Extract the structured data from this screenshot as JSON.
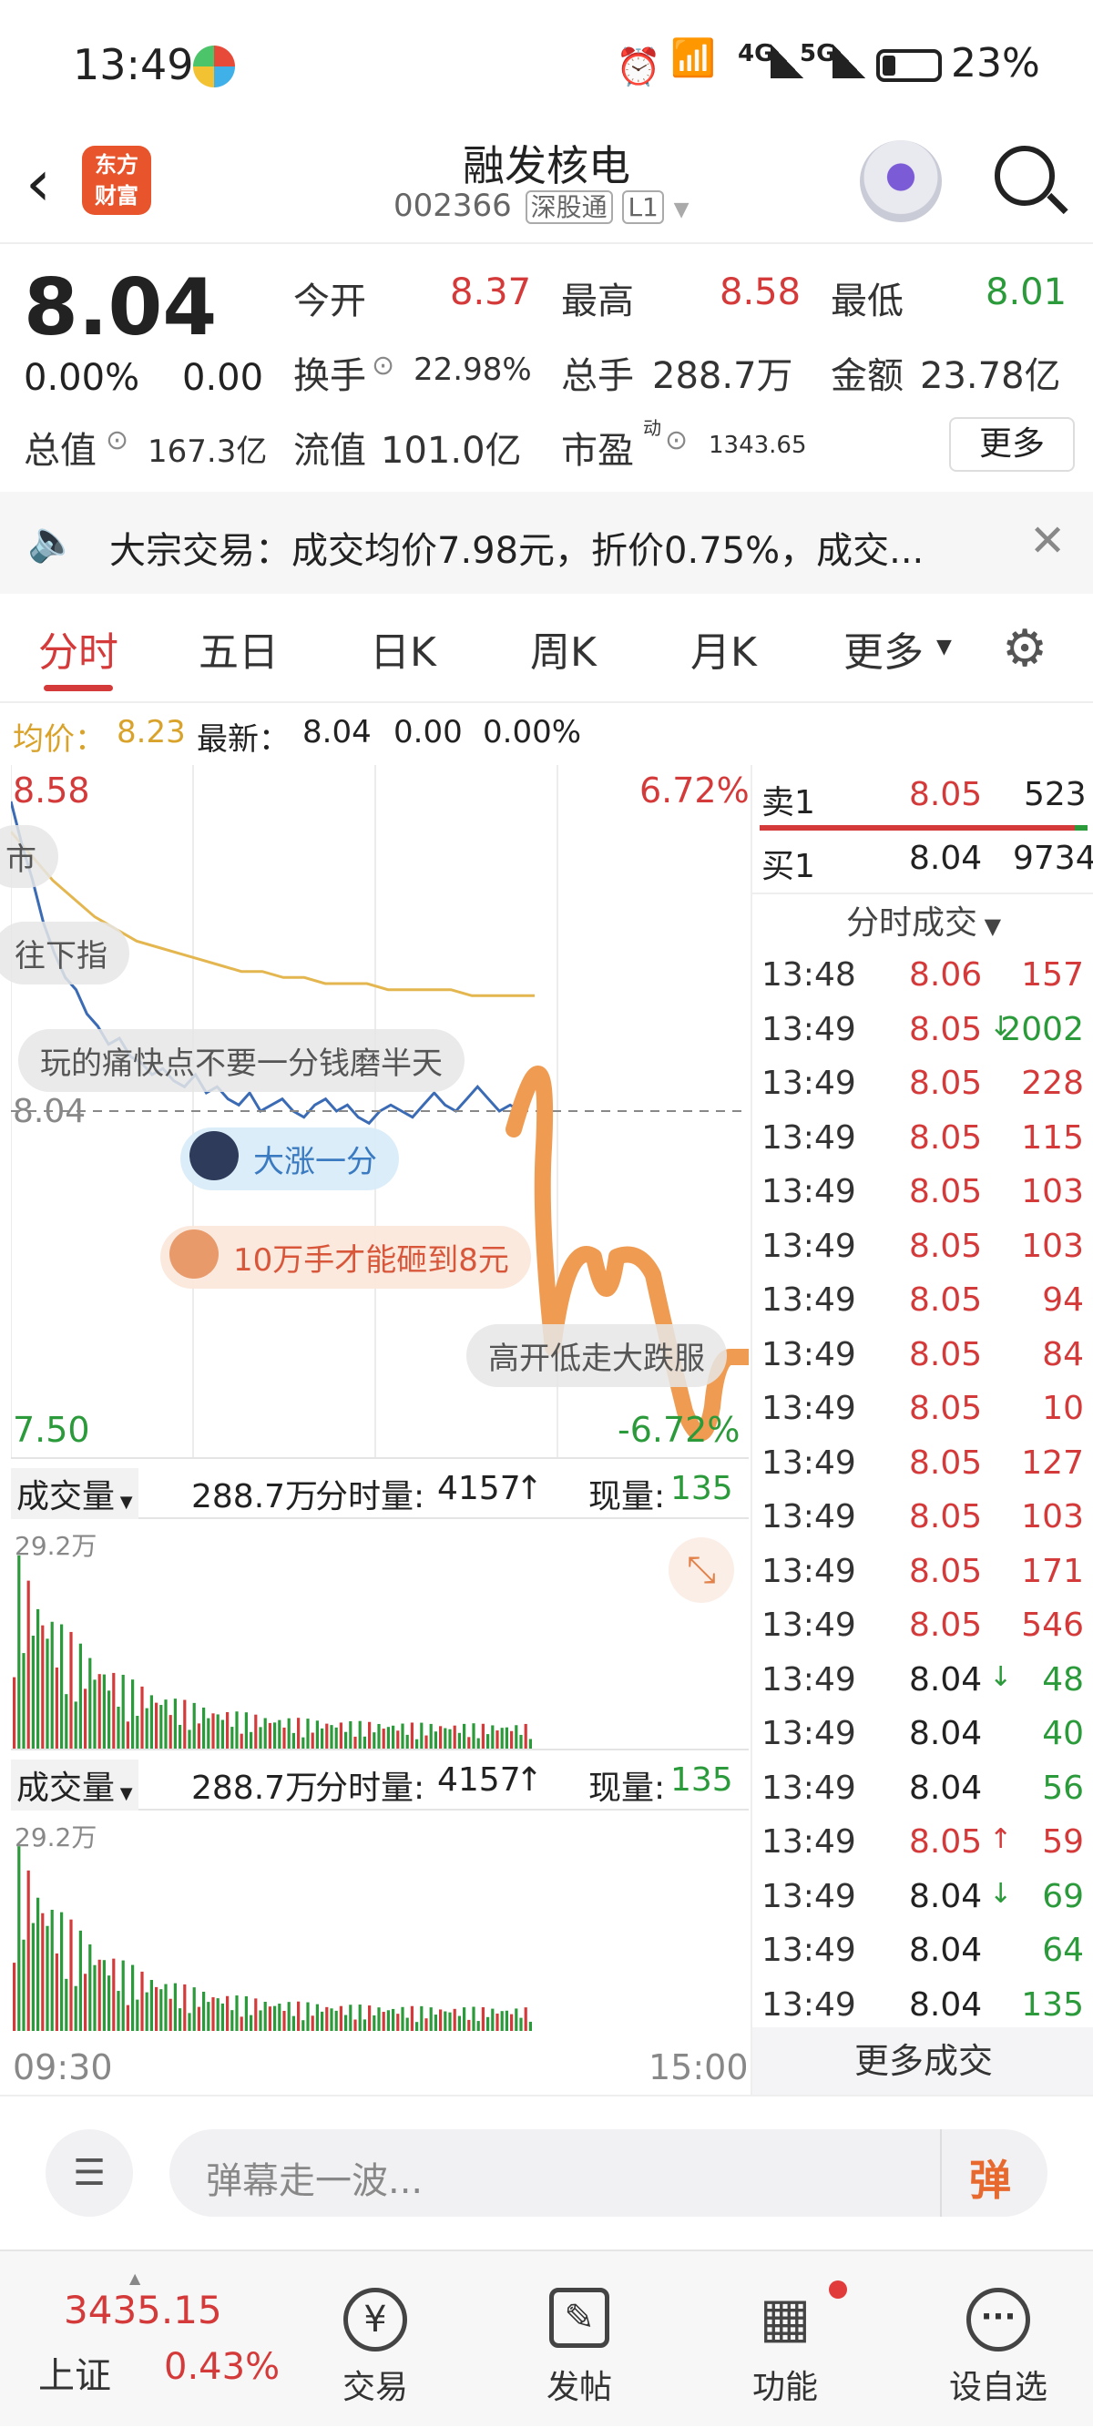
{
  "status": {
    "time": "13:49",
    "wifi_label": "6",
    "net1": "4G",
    "net2": "5G",
    "battery": "23%"
  },
  "nav": {
    "title": "融发核电",
    "code": "002366",
    "market": "深股通",
    "level": "L1",
    "logo_line1": "东方",
    "logo_line2": "财富"
  },
  "quote": {
    "price": "8.04",
    "change_pct": "0.00%",
    "change": "0.00",
    "open_label": "今开",
    "open": "8.37",
    "high_label": "最高",
    "high": "8.58",
    "low_label": "最低",
    "low": "8.01",
    "turnover_label": "换手",
    "turnover": "22.98%",
    "vol_label": "总手",
    "vol": "288.7万",
    "amount_label": "金额",
    "amount": "23.78亿",
    "mktcap_label": "总值",
    "mktcap": "167.3亿",
    "float_label": "流值",
    "float": "101.0亿",
    "pe_label": "市盈",
    "pe_sup": "动",
    "pe": "1343.65",
    "more": "更多"
  },
  "notice": {
    "text": "大宗交易：成交均价7.98元，折价0.75%，成交..."
  },
  "tabs": [
    "分时",
    "五日",
    "日K",
    "周K",
    "月K",
    "更多"
  ],
  "info": {
    "avg_label": "均价：",
    "avg": "8.23",
    "latest_label": "最新：",
    "latest": "8.04",
    "chg": "0.00",
    "pct": "0.00%"
  },
  "chart_data": {
    "type": "line",
    "title": "",
    "y_range": [
      7.5,
      8.58
    ],
    "y_pct_range": [
      "-6.72%",
      "6.72%"
    ],
    "ref_price": "8.04",
    "x_start": "09:30",
    "x_end": "15:00",
    "labels": {
      "ymax": "8.58",
      "ymin": "7.50",
      "pct_max": "6.72%",
      "pct_min": "-6.72%",
      "ref": "8.04"
    },
    "price": [
      8.55,
      8.48,
      8.42,
      8.35,
      8.3,
      8.26,
      8.24,
      8.2,
      8.18,
      8.15,
      8.16,
      8.13,
      8.12,
      8.1,
      8.11,
      8.09,
      8.08,
      8.1,
      8.07,
      8.08,
      8.06,
      8.05,
      8.07,
      8.04,
      8.05,
      8.06,
      8.04,
      8.03,
      8.05,
      8.06,
      8.04,
      8.05,
      8.03,
      8.02,
      8.04,
      8.05,
      8.04,
      8.03,
      8.05,
      8.07,
      8.05,
      8.04,
      8.06,
      8.08,
      8.06,
      8.04,
      8.05,
      8.04
    ],
    "avg": [
      8.5,
      8.46,
      8.42,
      8.39,
      8.36,
      8.34,
      8.32,
      8.31,
      8.3,
      8.29,
      8.28,
      8.27,
      8.27,
      8.26,
      8.26,
      8.25,
      8.25,
      8.25,
      8.24,
      8.24,
      8.24,
      8.24,
      8.23,
      8.23,
      8.23,
      8.23
    ]
  },
  "volume": {
    "label": "成交量",
    "total": "288.7万",
    "period_label": "分时量:",
    "period": "4157",
    "current_label": "现量:",
    "current": "135",
    "max": "29.2万"
  },
  "danmaku": [
    "市",
    "往下指",
    "玩的痛快点不要一分钱磨半天",
    "大涨一分",
    "10万手才能砸到8元",
    "高开低走大跌服"
  ],
  "book": {
    "ask_label": "卖1",
    "ask_price": "8.05",
    "ask_vol": "523",
    "bid_label": "买1",
    "bid_price": "8.04",
    "bid_vol": "9734",
    "ticks_title": "分时成交",
    "more": "更多成交",
    "ticks": [
      {
        "t": "13:48",
        "p": "8.06",
        "v": "157",
        "pc": "red",
        "vc": "red",
        "arrow": ""
      },
      {
        "t": "13:49",
        "p": "8.05",
        "v": "2002",
        "pc": "red",
        "vc": "green",
        "arrow": "↓"
      },
      {
        "t": "13:49",
        "p": "8.05",
        "v": "228",
        "pc": "red",
        "vc": "red",
        "arrow": ""
      },
      {
        "t": "13:49",
        "p": "8.05",
        "v": "115",
        "pc": "red",
        "vc": "red",
        "arrow": ""
      },
      {
        "t": "13:49",
        "p": "8.05",
        "v": "103",
        "pc": "red",
        "vc": "red",
        "arrow": ""
      },
      {
        "t": "13:49",
        "p": "8.05",
        "v": "103",
        "pc": "red",
        "vc": "red",
        "arrow": ""
      },
      {
        "t": "13:49",
        "p": "8.05",
        "v": "94",
        "pc": "red",
        "vc": "red",
        "arrow": ""
      },
      {
        "t": "13:49",
        "p": "8.05",
        "v": "84",
        "pc": "red",
        "vc": "red",
        "arrow": ""
      },
      {
        "t": "13:49",
        "p": "8.05",
        "v": "10",
        "pc": "red",
        "vc": "red",
        "arrow": ""
      },
      {
        "t": "13:49",
        "p": "8.05",
        "v": "127",
        "pc": "red",
        "vc": "red",
        "arrow": ""
      },
      {
        "t": "13:49",
        "p": "8.05",
        "v": "103",
        "pc": "red",
        "vc": "red",
        "arrow": ""
      },
      {
        "t": "13:49",
        "p": "8.05",
        "v": "171",
        "pc": "red",
        "vc": "red",
        "arrow": ""
      },
      {
        "t": "13:49",
        "p": "8.05",
        "v": "546",
        "pc": "red",
        "vc": "red",
        "arrow": ""
      },
      {
        "t": "13:49",
        "p": "8.04",
        "v": "48",
        "pc": "dark",
        "vc": "green",
        "arrow": "↓"
      },
      {
        "t": "13:49",
        "p": "8.04",
        "v": "40",
        "pc": "dark",
        "vc": "green",
        "arrow": ""
      },
      {
        "t": "13:49",
        "p": "8.04",
        "v": "56",
        "pc": "dark",
        "vc": "green",
        "arrow": ""
      },
      {
        "t": "13:49",
        "p": "8.05",
        "v": "59",
        "pc": "red",
        "vc": "red",
        "arrow": "↑"
      },
      {
        "t": "13:49",
        "p": "8.04",
        "v": "69",
        "pc": "dark",
        "vc": "green",
        "arrow": "↓"
      },
      {
        "t": "13:49",
        "p": "8.04",
        "v": "64",
        "pc": "dark",
        "vc": "green",
        "arrow": ""
      },
      {
        "t": "13:49",
        "p": "8.04",
        "v": "135",
        "pc": "dark",
        "vc": "green",
        "arrow": ""
      }
    ]
  },
  "danmu_input": {
    "placeholder": "弹幕走一波...",
    "send": "弹"
  },
  "footer": {
    "index_value": "3435.15",
    "index_name": "上证",
    "index_pct": "0.43%",
    "trade": "交易",
    "post": "发帖",
    "func": "功能",
    "watch": "设自选"
  }
}
